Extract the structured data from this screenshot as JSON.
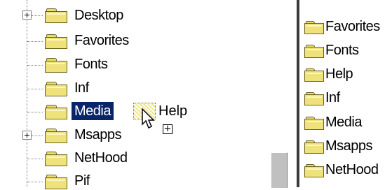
{
  "tree": {
    "items": [
      {
        "label": "Desktop",
        "expandable": true
      },
      {
        "label": "Favorites",
        "expandable": false
      },
      {
        "label": "Fonts",
        "expandable": false
      },
      {
        "label": "Inf",
        "expandable": false
      },
      {
        "label": "Media",
        "expandable": false,
        "selected": true
      },
      {
        "label": "Msapps",
        "expandable": true
      },
      {
        "label": "NetHood",
        "expandable": false
      },
      {
        "label": "Pif",
        "expandable": false
      }
    ]
  },
  "drag": {
    "label": "Help",
    "copy_glyph": "+"
  },
  "list": {
    "items": [
      {
        "label": "Favorites"
      },
      {
        "label": "Fonts"
      },
      {
        "label": "Help"
      },
      {
        "label": "Inf"
      },
      {
        "label": "Media"
      },
      {
        "label": "Msapps"
      },
      {
        "label": "NetHood"
      }
    ]
  },
  "colors": {
    "selection": "#0a246a",
    "folder": "#efe27a",
    "divider": "#3b3b3b"
  }
}
